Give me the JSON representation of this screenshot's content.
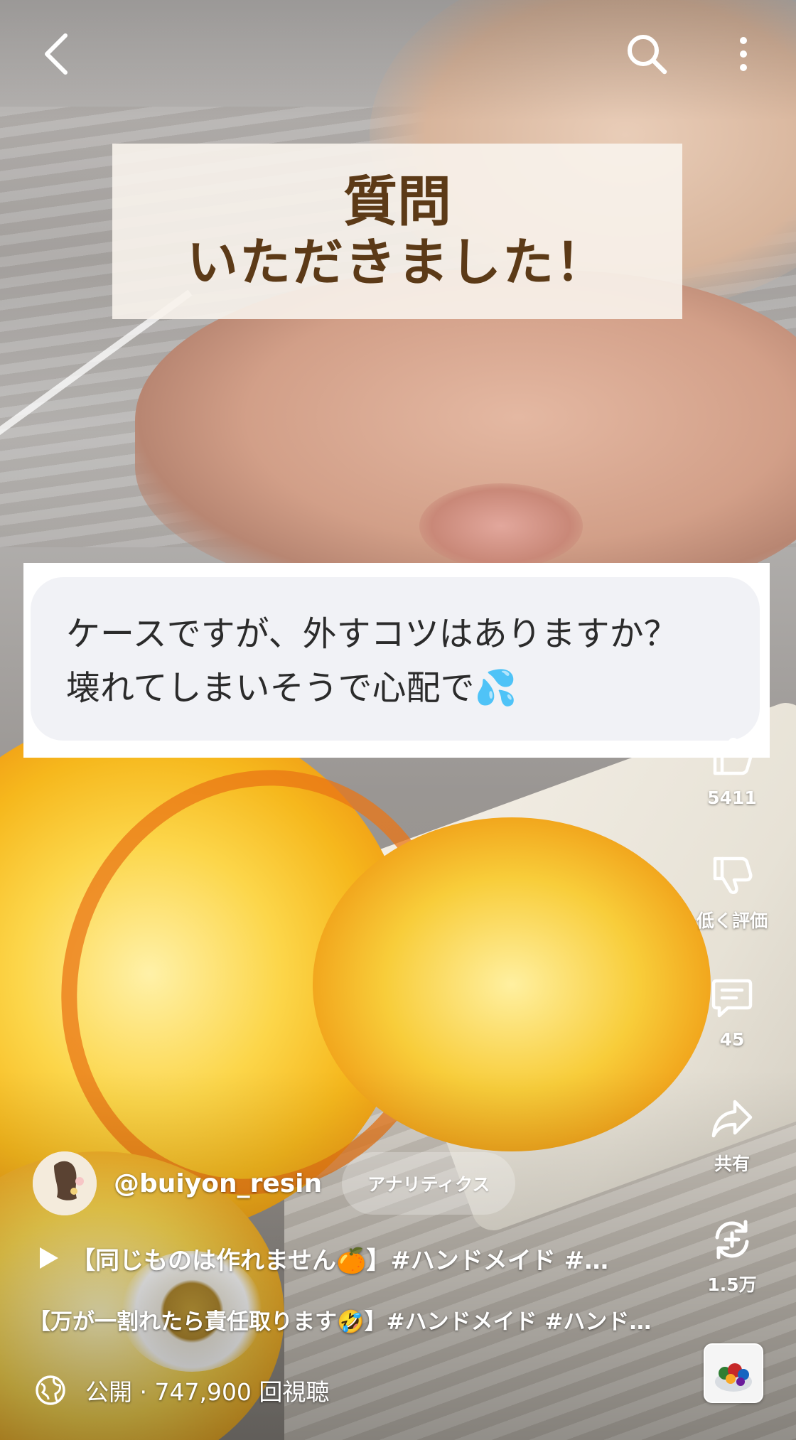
{
  "video": {
    "caption_title": {
      "line1": "質問",
      "line2": "いただきました！"
    },
    "question": {
      "line1": "ケースですが、外すコツはありますか？",
      "line2": "壊れてしまいそうで心配で💦"
    }
  },
  "top_bar": {
    "back_icon": "chevron-left-icon",
    "search_icon": "search-icon",
    "more_icon": "more-vertical-icon"
  },
  "actions": {
    "like_count": "5411",
    "dislike_label": "低く評価",
    "comment_count": "45",
    "share_label": "共有",
    "remix_count": "1.5万"
  },
  "channel": {
    "name": "@buiyon_resin",
    "analytics_label": "アナリティクス"
  },
  "title": {
    "main": "【同じものは作れません🍊】#ハンドメイド #…",
    "sub": "【万が一割れたら責任取ります🤣】#ハンドメイド #ハンド …"
  },
  "meta": {
    "visibility_views": "公開 · 747,900 回視聴"
  },
  "colors": {
    "title_text": "#5c3a17",
    "icon": "#ffffff"
  }
}
